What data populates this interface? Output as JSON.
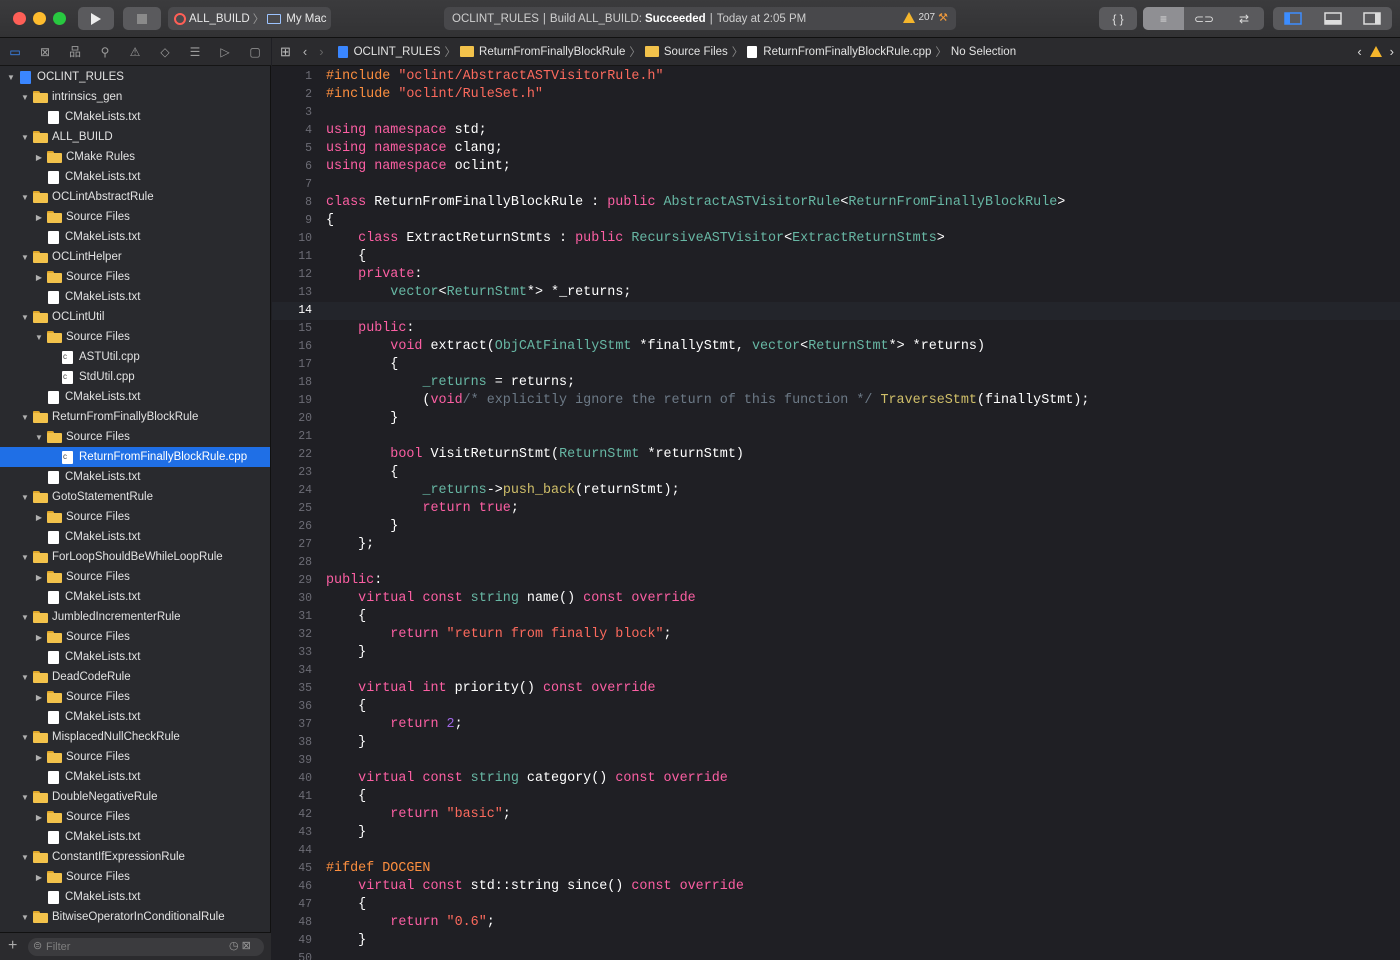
{
  "toolbar": {
    "scheme": "ALL_BUILD",
    "destination": "My Mac",
    "activity": {
      "project": "OCLINT_RULES",
      "build_label": "Build ALL_BUILD:",
      "build_status": "Succeeded",
      "time": "Today at 2:05 PM",
      "warnings": "207"
    },
    "editor_buttons": [
      "{ }",
      "≡",
      "⊂⊃",
      "⇄"
    ]
  },
  "navigator_icons": [
    "folder-icon",
    "source-control-icon",
    "hierarchy-icon",
    "search-icon",
    "warning-icon",
    "test-icon",
    "debug-icon",
    "breakpoint-icon",
    "report-icon"
  ],
  "tree": [
    {
      "label": "OCLINT_RULES",
      "depth": 0,
      "kind": "project",
      "open": true
    },
    {
      "label": "intrinsics_gen",
      "depth": 1,
      "kind": "folder",
      "open": true
    },
    {
      "label": "CMakeLists.txt",
      "depth": 2,
      "kind": "file"
    },
    {
      "label": "ALL_BUILD",
      "depth": 1,
      "kind": "folder",
      "open": true
    },
    {
      "label": "CMake Rules",
      "depth": 2,
      "kind": "folder",
      "open": false
    },
    {
      "label": "CMakeLists.txt",
      "depth": 2,
      "kind": "file"
    },
    {
      "label": "OCLintAbstractRule",
      "depth": 1,
      "kind": "folder",
      "open": true
    },
    {
      "label": "Source Files",
      "depth": 2,
      "kind": "folder",
      "open": false
    },
    {
      "label": "CMakeLists.txt",
      "depth": 2,
      "kind": "file"
    },
    {
      "label": "OCLintHelper",
      "depth": 1,
      "kind": "folder",
      "open": true
    },
    {
      "label": "Source Files",
      "depth": 2,
      "kind": "folder",
      "open": false
    },
    {
      "label": "CMakeLists.txt",
      "depth": 2,
      "kind": "file"
    },
    {
      "label": "OCLintUtil",
      "depth": 1,
      "kind": "folder",
      "open": true
    },
    {
      "label": "Source Files",
      "depth": 2,
      "kind": "folder",
      "open": true
    },
    {
      "label": "ASTUtil.cpp",
      "depth": 3,
      "kind": "cpp"
    },
    {
      "label": "StdUtil.cpp",
      "depth": 3,
      "kind": "cpp"
    },
    {
      "label": "CMakeLists.txt",
      "depth": 2,
      "kind": "file"
    },
    {
      "label": "ReturnFromFinallyBlockRule",
      "depth": 1,
      "kind": "folder",
      "open": true
    },
    {
      "label": "Source Files",
      "depth": 2,
      "kind": "folder",
      "open": true
    },
    {
      "label": "ReturnFromFinallyBlockRule.cpp",
      "depth": 3,
      "kind": "cpp",
      "selected": true
    },
    {
      "label": "CMakeLists.txt",
      "depth": 2,
      "kind": "file"
    },
    {
      "label": "GotoStatementRule",
      "depth": 1,
      "kind": "folder",
      "open": true
    },
    {
      "label": "Source Files",
      "depth": 2,
      "kind": "folder",
      "open": false
    },
    {
      "label": "CMakeLists.txt",
      "depth": 2,
      "kind": "file"
    },
    {
      "label": "ForLoopShouldBeWhileLoopRule",
      "depth": 1,
      "kind": "folder",
      "open": true
    },
    {
      "label": "Source Files",
      "depth": 2,
      "kind": "folder",
      "open": false
    },
    {
      "label": "CMakeLists.txt",
      "depth": 2,
      "kind": "file"
    },
    {
      "label": "JumbledIncrementerRule",
      "depth": 1,
      "kind": "folder",
      "open": true
    },
    {
      "label": "Source Files",
      "depth": 2,
      "kind": "folder",
      "open": false
    },
    {
      "label": "CMakeLists.txt",
      "depth": 2,
      "kind": "file"
    },
    {
      "label": "DeadCodeRule",
      "depth": 1,
      "kind": "folder",
      "open": true
    },
    {
      "label": "Source Files",
      "depth": 2,
      "kind": "folder",
      "open": false
    },
    {
      "label": "CMakeLists.txt",
      "depth": 2,
      "kind": "file"
    },
    {
      "label": "MisplacedNullCheckRule",
      "depth": 1,
      "kind": "folder",
      "open": true
    },
    {
      "label": "Source Files",
      "depth": 2,
      "kind": "folder",
      "open": false
    },
    {
      "label": "CMakeLists.txt",
      "depth": 2,
      "kind": "file"
    },
    {
      "label": "DoubleNegativeRule",
      "depth": 1,
      "kind": "folder",
      "open": true
    },
    {
      "label": "Source Files",
      "depth": 2,
      "kind": "folder",
      "open": false
    },
    {
      "label": "CMakeLists.txt",
      "depth": 2,
      "kind": "file"
    },
    {
      "label": "ConstantIfExpressionRule",
      "depth": 1,
      "kind": "folder",
      "open": true
    },
    {
      "label": "Source Files",
      "depth": 2,
      "kind": "folder",
      "open": false
    },
    {
      "label": "CMakeLists.txt",
      "depth": 2,
      "kind": "file"
    },
    {
      "label": "BitwiseOperatorInConditionalRule",
      "depth": 1,
      "kind": "folder",
      "open": true
    }
  ],
  "filter": {
    "placeholder": "Filter"
  },
  "jumpbar": {
    "crumbs": [
      "OCLINT_RULES",
      "ReturnFromFinallyBlockRule",
      "Source Files",
      "ReturnFromFinallyBlockRule.cpp",
      "No Selection"
    ]
  },
  "editor": {
    "current_line": 14,
    "lines": [
      [
        [
          "p",
          "#include "
        ],
        [
          "s",
          "\"oclint/AbstractASTVisitorRule.h\""
        ]
      ],
      [
        [
          "p",
          "#include "
        ],
        [
          "s",
          "\"oclint/RuleSet.h\""
        ]
      ],
      [],
      [
        [
          "k",
          "using namespace "
        ],
        [
          "",
          "std;"
        ]
      ],
      [
        [
          "k",
          "using namespace "
        ],
        [
          "",
          "clang;"
        ]
      ],
      [
        [
          "k",
          "using namespace "
        ],
        [
          "",
          "oclint;"
        ]
      ],
      [],
      [
        [
          "k",
          "class "
        ],
        [
          "",
          "ReturnFromFinallyBlockRule : "
        ],
        [
          "k",
          "public "
        ],
        [
          "t",
          "AbstractASTVisitorRule"
        ],
        [
          "",
          "<"
        ],
        [
          "t",
          "ReturnFromFinallyBlockRule"
        ],
        [
          "",
          ">"
        ]
      ],
      [
        [
          "",
          "{"
        ]
      ],
      [
        [
          "",
          "    "
        ],
        [
          "k",
          "class "
        ],
        [
          "",
          "ExtractReturnStmts : "
        ],
        [
          "k",
          "public "
        ],
        [
          "t",
          "RecursiveASTVisitor"
        ],
        [
          "",
          "<"
        ],
        [
          "t",
          "ExtractReturnStmts"
        ],
        [
          "",
          ">"
        ]
      ],
      [
        [
          "",
          "    {"
        ]
      ],
      [
        [
          "",
          "    "
        ],
        [
          "k",
          "private"
        ],
        [
          "",
          ":"
        ]
      ],
      [
        [
          "",
          "        "
        ],
        [
          "t",
          "vector"
        ],
        [
          "",
          "<"
        ],
        [
          "t",
          "ReturnStmt"
        ],
        [
          "",
          "*> *_returns;"
        ]
      ],
      [],
      [
        [
          "",
          "    "
        ],
        [
          "k",
          "public"
        ],
        [
          "",
          ":"
        ]
      ],
      [
        [
          "",
          "        "
        ],
        [
          "k",
          "void "
        ],
        [
          "",
          "extract("
        ],
        [
          "t",
          "ObjCAtFinallyStmt"
        ],
        [
          "",
          " *finallyStmt, "
        ],
        [
          "t",
          "vector"
        ],
        [
          "",
          "<"
        ],
        [
          "t",
          "ReturnStmt"
        ],
        [
          "",
          "*> *returns)"
        ]
      ],
      [
        [
          "",
          "        {"
        ]
      ],
      [
        [
          "",
          "            "
        ],
        [
          "t",
          "_returns"
        ],
        [
          "",
          " = returns;"
        ]
      ],
      [
        [
          "",
          "            ("
        ],
        [
          "k",
          "void"
        ],
        [
          ") "
        ],
        [
          "c",
          "/* explicitly ignore the return of this function */ "
        ],
        [
          "n",
          "TraverseStmt"
        ],
        [
          "",
          "(finallyStmt);"
        ]
      ],
      [
        [
          "",
          "        }"
        ]
      ],
      [],
      [
        [
          "",
          "        "
        ],
        [
          "k",
          "bool "
        ],
        [
          "",
          "VisitReturnStmt("
        ],
        [
          "t",
          "ReturnStmt"
        ],
        [
          "",
          " *returnStmt)"
        ]
      ],
      [
        [
          "",
          "        {"
        ]
      ],
      [
        [
          "",
          "            "
        ],
        [
          "t",
          "_returns"
        ],
        [
          "",
          "->"
        ],
        [
          "n",
          "push_back"
        ],
        [
          "",
          "(returnStmt);"
        ]
      ],
      [
        [
          "",
          "            "
        ],
        [
          "k",
          "return "
        ],
        [
          "k",
          "true"
        ],
        [
          "",
          ";"
        ]
      ],
      [
        [
          "",
          "        }"
        ]
      ],
      [
        [
          "",
          "    };"
        ]
      ],
      [],
      [
        [
          "k",
          "public"
        ],
        [
          "",
          ":"
        ]
      ],
      [
        [
          "",
          "    "
        ],
        [
          "k",
          "virtual const "
        ],
        [
          "t",
          "string "
        ],
        [
          "",
          "name() "
        ],
        [
          "k",
          "const override"
        ]
      ],
      [
        [
          "",
          "    {"
        ]
      ],
      [
        [
          "",
          "        "
        ],
        [
          "k",
          "return "
        ],
        [
          "s",
          "\"return from finally block\""
        ],
        [
          "",
          ";"
        ]
      ],
      [
        [
          "",
          "    }"
        ]
      ],
      [],
      [
        [
          "",
          "    "
        ],
        [
          "k",
          "virtual int "
        ],
        [
          "",
          "priority() "
        ],
        [
          "k",
          "const override"
        ]
      ],
      [
        [
          "",
          "    {"
        ]
      ],
      [
        [
          "",
          "        "
        ],
        [
          "k",
          "return "
        ],
        [
          "f",
          "2"
        ],
        [
          "",
          ";"
        ]
      ],
      [
        [
          "",
          "    }"
        ]
      ],
      [],
      [
        [
          "",
          "    "
        ],
        [
          "k",
          "virtual const "
        ],
        [
          "t",
          "string "
        ],
        [
          "",
          "category() "
        ],
        [
          "k",
          "const override"
        ]
      ],
      [
        [
          "",
          "    {"
        ]
      ],
      [
        [
          "",
          "        "
        ],
        [
          "k",
          "return "
        ],
        [
          "s",
          "\"basic\""
        ],
        [
          "",
          ";"
        ]
      ],
      [
        [
          "",
          "    }"
        ]
      ],
      [],
      [
        [
          "p",
          "#ifdef DOCGEN"
        ]
      ],
      [
        [
          "",
          "    "
        ],
        [
          "k",
          "virtual const "
        ],
        [
          "",
          "std::string since() "
        ],
        [
          "k",
          "const override"
        ]
      ],
      [
        [
          "",
          "    {"
        ]
      ],
      [
        [
          "",
          "        "
        ],
        [
          "k",
          "return "
        ],
        [
          "s",
          "\"0.6\""
        ],
        [
          "",
          ";"
        ]
      ],
      [
        [
          "",
          "    }"
        ]
      ],
      []
    ]
  }
}
